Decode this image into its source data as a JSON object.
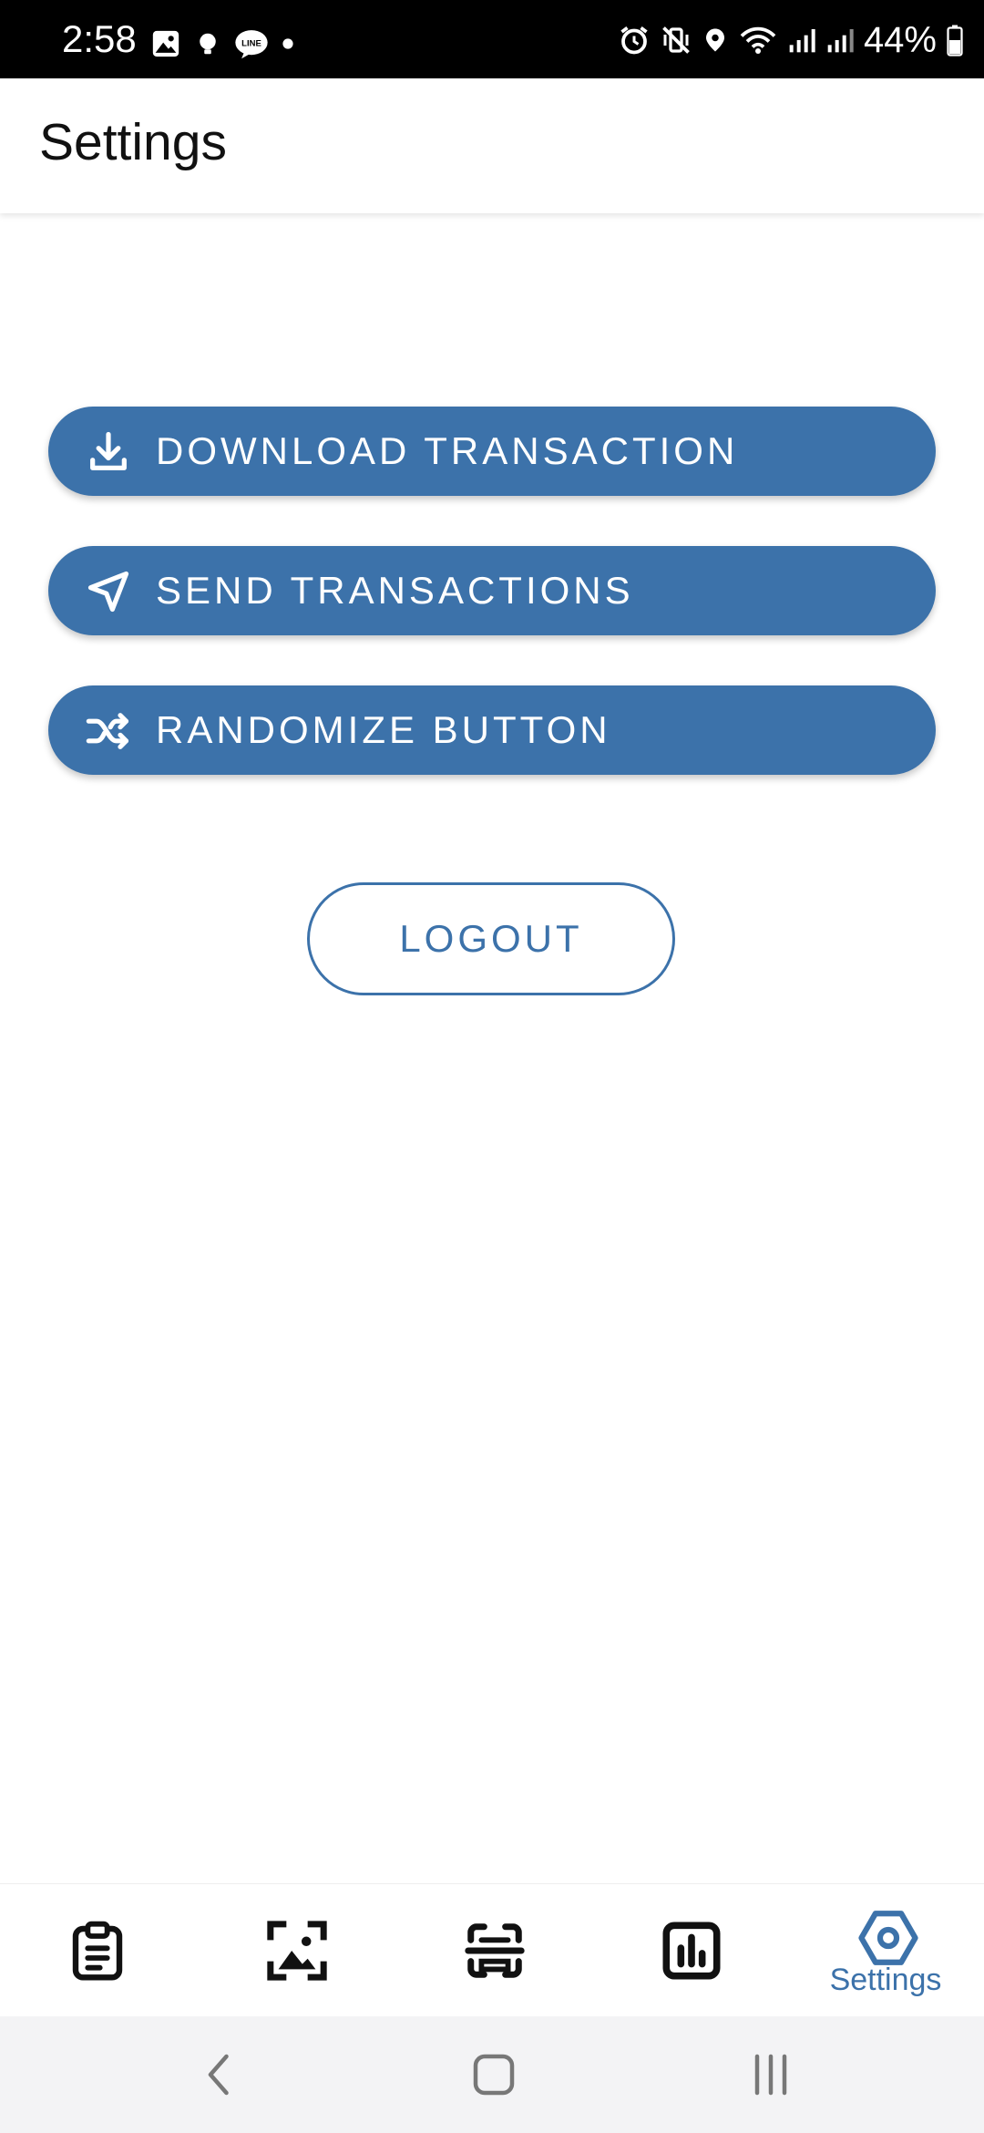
{
  "status_bar": {
    "time": "2:58",
    "battery": "44%"
  },
  "app_bar": {
    "title": "Settings"
  },
  "actions": {
    "download_label": "DOWNLOAD TRANSACTION",
    "send_label": "SEND TRANSACTIONS",
    "randomize_label": "RANDOMIZE BUTTON",
    "logout_label": "LOGOUT"
  },
  "bottom_nav": {
    "items": [
      {
        "icon": "clipboard-icon"
      },
      {
        "icon": "image-icon"
      },
      {
        "icon": "scan-icon"
      },
      {
        "icon": "chart-icon"
      },
      {
        "icon": "settings-icon",
        "label": "Settings",
        "active": true
      }
    ]
  },
  "colors": {
    "accent": "#3c72aa",
    "background": "#ffffff",
    "status_bar": "#000000"
  }
}
